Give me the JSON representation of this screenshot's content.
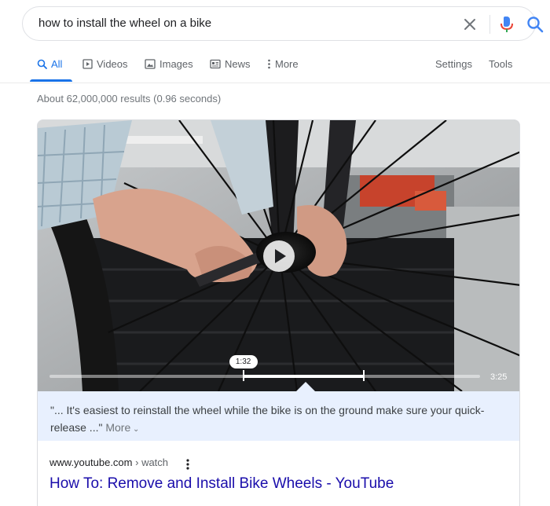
{
  "search": {
    "query": "how to install the wheel on a bike"
  },
  "tabs": [
    {
      "label": "All",
      "icon": "search-icon"
    },
    {
      "label": "Videos",
      "icon": "video-icon"
    },
    {
      "label": "Images",
      "icon": "image-icon"
    },
    {
      "label": "News",
      "icon": "news-icon"
    },
    {
      "label": "More",
      "icon": "more-vert-icon"
    }
  ],
  "tools": {
    "settings": "Settings",
    "tools": "Tools"
  },
  "stats": "About 62,000,000 results (0.96 seconds)",
  "video": {
    "clip_start": "1:32",
    "duration": "3:25",
    "progress_start_fraction": 0.45,
    "progress_end_fraction": 0.73
  },
  "snippet": {
    "text": "\"... It's easiest to reinstall the wheel while the bike is on the ground make sure your quick-release ...\"",
    "more": "More"
  },
  "result": {
    "domain": "www.youtube.com",
    "path": "› watch",
    "title": "How To: Remove and Install Bike Wheels - YouTube"
  },
  "colors": {
    "link": "#1a0dab",
    "accent": "#1a73e8",
    "snippet_bg": "#e8f0fe"
  }
}
